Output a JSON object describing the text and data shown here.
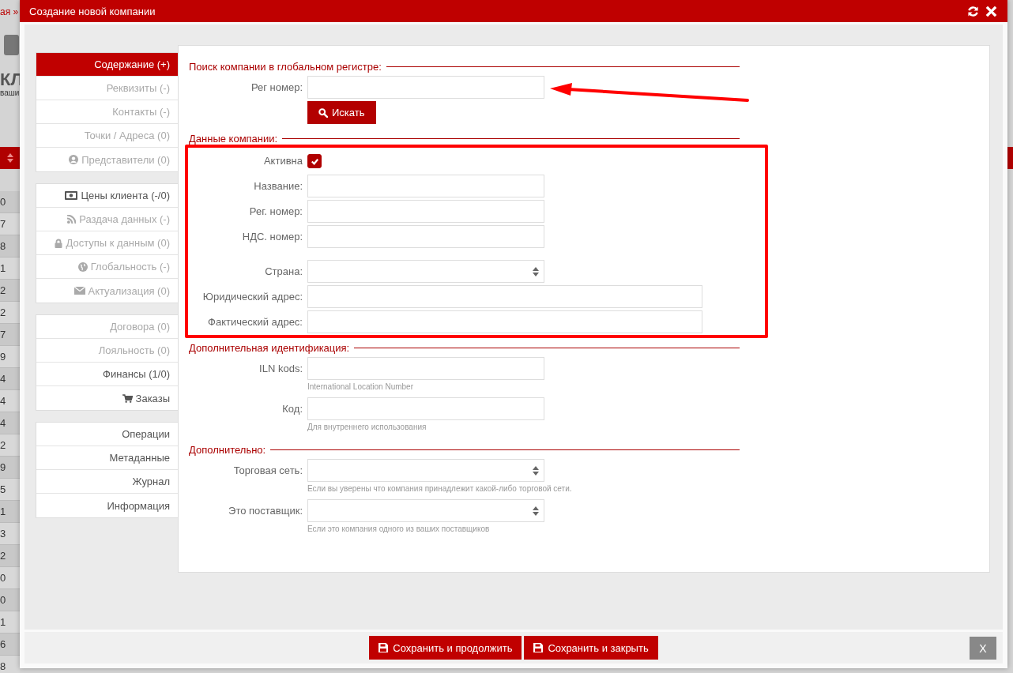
{
  "background_page": {
    "breadcrumb": "ая »",
    "heading": "КЛ",
    "subheading": "ваши",
    "row_numbers": [
      "0",
      "7",
      "8",
      "1",
      "2",
      "2",
      "7",
      "9",
      "4",
      "4",
      "4",
      "2",
      "9",
      "5",
      "1",
      "3",
      "2",
      "0",
      "0",
      "1",
      "6",
      "8"
    ]
  },
  "dialog": {
    "title": "Создание новой компании"
  },
  "sidebar": {
    "groups": [
      [
        {
          "label": "Содержание (+)",
          "selected": true,
          "disabled": false
        },
        {
          "label": "Реквизиты (-)",
          "selected": false,
          "disabled": true
        },
        {
          "label": "Контакты (-)",
          "selected": false,
          "disabled": true
        },
        {
          "label": "Точки / Адреса (0)",
          "selected": false,
          "disabled": true
        },
        {
          "label": "Представители (0)",
          "selected": false,
          "disabled": true
        }
      ],
      [
        {
          "label": "Цены клиента (-/0)",
          "selected": false,
          "disabled": false
        },
        {
          "label": "Раздача данных (-)",
          "selected": false,
          "disabled": true
        },
        {
          "label": "Доступы к данным (0)",
          "selected": false,
          "disabled": true
        },
        {
          "label": "Глобальность (-)",
          "selected": false,
          "disabled": true
        },
        {
          "label": "Актуализация (0)",
          "selected": false,
          "disabled": true
        }
      ],
      [
        {
          "label": "Договора (0)",
          "selected": false,
          "disabled": true
        },
        {
          "label": "Лояльность (0)",
          "selected": false,
          "disabled": true
        },
        {
          "label": "Финансы (1/0)",
          "selected": false,
          "disabled": false
        },
        {
          "label": "Заказы",
          "selected": false,
          "disabled": false
        }
      ],
      [
        {
          "label": "Операции",
          "selected": false,
          "disabled": false
        },
        {
          "label": "Метаданные",
          "selected": false,
          "disabled": false
        },
        {
          "label": "Журнал",
          "selected": false,
          "disabled": false
        },
        {
          "label": "Информация",
          "selected": false,
          "disabled": false
        }
      ]
    ]
  },
  "sections": [
    {
      "title": "Поиск компании в глобальном регистре:",
      "button": {
        "label": "Искать"
      },
      "field_groups": [
        [
          {
            "kind": "text",
            "label": "Рег номер:",
            "wide": false
          }
        ]
      ]
    },
    {
      "title": "Данные компании:",
      "field_groups": [
        [
          {
            "kind": "checkbox",
            "label": "Активна",
            "checked": true
          },
          {
            "kind": "text",
            "label": "Название:",
            "wide": false
          },
          {
            "kind": "text",
            "label": "Рег. номер:",
            "wide": false
          },
          {
            "kind": "text",
            "label": "НДС. номер:",
            "wide": false
          }
        ],
        [
          {
            "kind": "select",
            "label": "Страна:",
            "wide": false
          },
          {
            "kind": "text",
            "label": "Юридический адрес:",
            "wide": true
          },
          {
            "kind": "text",
            "label": "Фактический адрес:",
            "wide": true
          }
        ]
      ]
    },
    {
      "title": "Дополнительная идентификация:",
      "field_groups": [
        [
          {
            "kind": "text",
            "label": "ILN kods:",
            "wide": false,
            "hint": "International Location Number"
          },
          {
            "kind": "text",
            "label": "Код:",
            "wide": false,
            "hint": "Для внутреннего использования"
          }
        ]
      ]
    },
    {
      "title": "Дополнительно:",
      "field_groups": [
        [
          {
            "kind": "select",
            "label": "Торговая сеть:",
            "wide": false,
            "hint": "Если вы уверены что компания принадлежит какой-либо торговой сети."
          },
          {
            "kind": "select",
            "label": "Это поставщик:",
            "wide": false,
            "hint": "Если это компания одного из ваших поставщиков"
          }
        ]
      ]
    }
  ],
  "footer": {
    "buttons": [
      {
        "label": "Сохранить и продолжить",
        "kind": "save"
      },
      {
        "label": "Сохранить и закрыть",
        "kind": "save"
      },
      {
        "label": "X",
        "kind": "close"
      }
    ]
  }
}
